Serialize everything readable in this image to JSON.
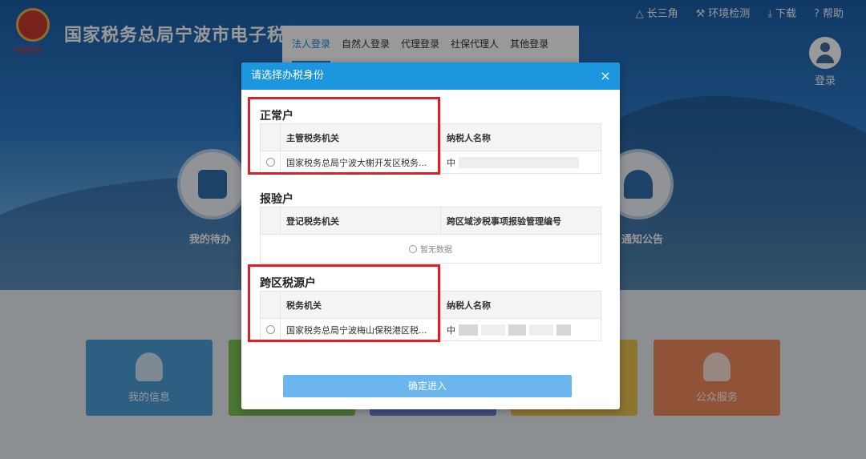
{
  "site": {
    "title": "国家税务总局宁波市电子税务局"
  },
  "topnav": [
    {
      "icon": "triangle-icon",
      "label": "长三角"
    },
    {
      "icon": "wrench-icon",
      "label": "环境检测"
    },
    {
      "icon": "download-icon",
      "label": "下载"
    },
    {
      "icon": "help-icon",
      "label": "帮助"
    }
  ],
  "user": {
    "login_label": "登录"
  },
  "login_tabs": [
    "法人登录",
    "自然人登录",
    "代理登录",
    "社保代理人",
    "其他登录"
  ],
  "hero": {
    "todo_label": "我的待办",
    "notice_label": "通知公告"
  },
  "tiles": [
    "我的信息",
    "",
    "",
    "",
    "公众服务"
  ],
  "modal": {
    "title": "请选择办税身份",
    "close_symbol": "×",
    "sections": [
      {
        "title": "正常户",
        "columns": [
          "主管税务机关",
          "纳税人名称"
        ],
        "rows": [
          {
            "authority": "国家税务总局宁波大榭开发区税务...",
            "name": "中"
          }
        ]
      },
      {
        "title": "报验户",
        "columns": [
          "登记税务机关",
          "跨区域涉税事项报验管理编号"
        ],
        "empty_text": "暂无数据"
      },
      {
        "title": "跨区税源户",
        "columns": [
          "税务机关",
          "纳税人名称"
        ],
        "rows": [
          {
            "authority": "国家税务总局宁波梅山保税港区税...",
            "name": "中"
          }
        ]
      }
    ],
    "confirm_label": "确定进入"
  },
  "colors": {
    "header_blue": "#1d96e0",
    "highlight_red": "#e21d25",
    "confirm_blue": "#6cb6ef",
    "tab_active": "#1e88e5"
  }
}
